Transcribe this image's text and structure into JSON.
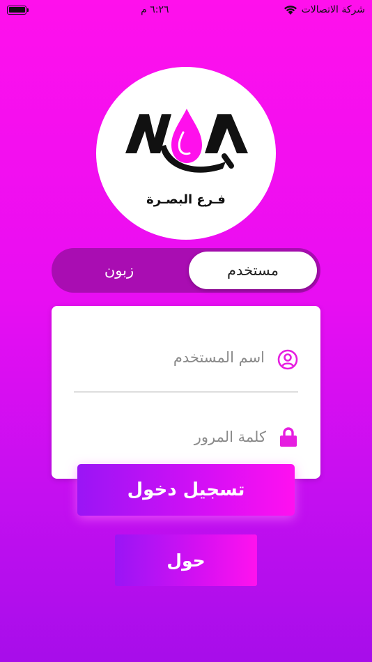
{
  "status_bar": {
    "carrier": "شركة الاتصالات",
    "time": "٦:٢٦ م"
  },
  "logo": {
    "caption": "فـرع البصـرة",
    "brand_color": "#ff10ec"
  },
  "toggle": {
    "active_label": "مستخدم",
    "inactive_label": "زبون"
  },
  "form": {
    "username_placeholder": "اسم المستخدم",
    "password_placeholder": "كلمة المرور",
    "icon_color": "#e61ee0",
    "eye_color": "#e05050"
  },
  "buttons": {
    "login_label": "تسجيل دخول",
    "about_label": "حول"
  }
}
